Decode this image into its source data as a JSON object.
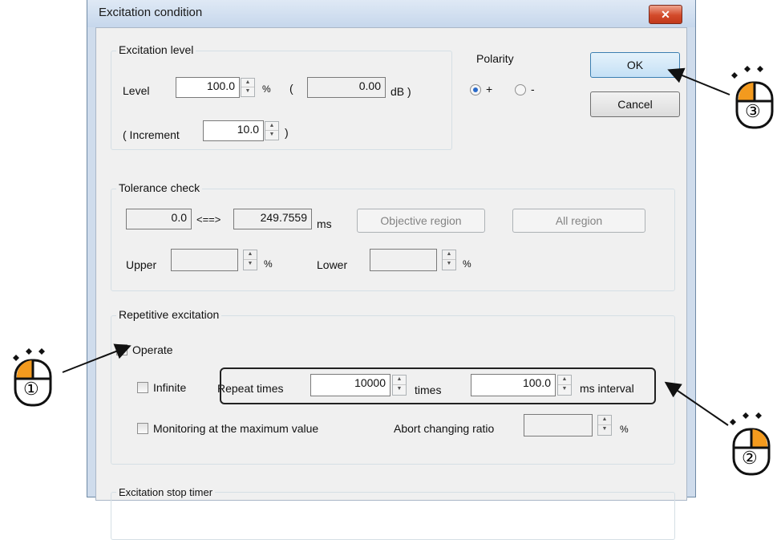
{
  "window": {
    "title": "Excitation condition",
    "close_glyph": "✕"
  },
  "excitation_level": {
    "group_label": "Excitation level",
    "level_label": "Level",
    "level_value": "100.0",
    "percent_unit": "%",
    "open_paren": "(",
    "db_value": "0.00",
    "db_unit": "dB )",
    "increment_label": "( Increment",
    "increment_value": "10.0",
    "close_paren": ")"
  },
  "polarity": {
    "group_label": "Polarity",
    "options": [
      "+",
      "-"
    ],
    "selected": "+"
  },
  "buttons": {
    "ok": "OK",
    "cancel": "Cancel"
  },
  "tolerance_check": {
    "group_label": "Tolerance check",
    "from_value": "0.0",
    "arrow": "<==>",
    "to_value": "249.7559",
    "unit": "ms",
    "objective_region": "Objective region",
    "all_region": "All region",
    "upper_label": "Upper",
    "upper_unit": "%",
    "lower_label": "Lower",
    "lower_unit": "%"
  },
  "repetitive_excitation": {
    "group_label": "Repetitive excitation",
    "operate_label": "Operate",
    "operate_checked": true,
    "infinite_label": "Infinite",
    "repeat_times_label": "Repeat times",
    "repeat_times_value": "10000",
    "times_unit": "times",
    "interval_value": "100.0",
    "interval_unit": "ms interval",
    "monitoring_label": "Monitoring at the maximum value",
    "abort_label": "Abort changing ratio",
    "abort_unit": "%"
  },
  "next_group_label": "Excitation stop timer",
  "callouts": {
    "one": "①",
    "two": "②",
    "three": "③"
  },
  "colors": {
    "mouse_accent": "#f39a1e",
    "highlight_border": "#222222"
  }
}
